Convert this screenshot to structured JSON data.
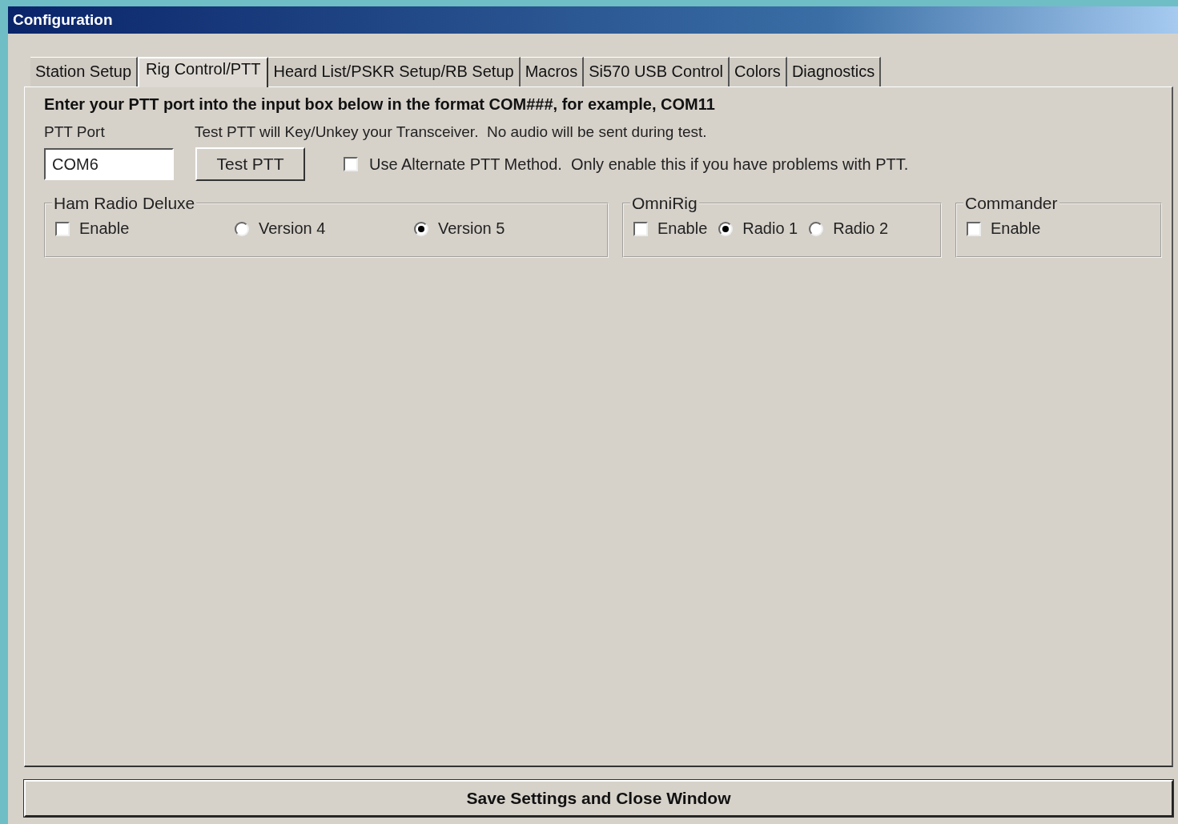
{
  "window": {
    "title": "Configuration"
  },
  "tabs": [
    {
      "label": "Station Setup",
      "selected": false
    },
    {
      "label": "Rig Control/PTT",
      "selected": true
    },
    {
      "label": "Heard List/PSKR Setup/RB Setup",
      "selected": false
    },
    {
      "label": "Macros",
      "selected": false
    },
    {
      "label": "Si570 USB Control",
      "selected": false
    },
    {
      "label": "Colors",
      "selected": false
    },
    {
      "label": "Diagnostics",
      "selected": false
    }
  ],
  "instruction": "Enter your PTT port into the input box below in the format COM###, for example, COM11",
  "ptt_port": {
    "label": "PTT Port",
    "value": "COM6"
  },
  "test_note": "Test PTT will Key/Unkey your Transceiver.  No audio will be sent during test.",
  "test_button": "Test PTT",
  "alternate": {
    "label": "Use Alternate PTT Method.  Only enable this if you have problems with PTT.",
    "checked": false
  },
  "groups": [
    {
      "title": "Ham Radio Deluxe",
      "items": [
        {
          "kind": "checkbox",
          "label": "Enable",
          "checked": false
        },
        {
          "kind": "radio",
          "label": "Version 4",
          "selected": false
        },
        {
          "kind": "radio",
          "label": "Version 5",
          "selected": true
        }
      ]
    },
    {
      "title": "OmniRig",
      "items": [
        {
          "kind": "checkbox",
          "label": "Enable",
          "checked": false
        },
        {
          "kind": "radio",
          "label": "Radio 1",
          "selected": true
        },
        {
          "kind": "radio",
          "label": "Radio 2",
          "selected": false
        }
      ]
    },
    {
      "title": "Commander",
      "items": [
        {
          "kind": "checkbox",
          "label": "Enable",
          "checked": false
        }
      ]
    }
  ],
  "save_button": "Save Settings and Close Window"
}
